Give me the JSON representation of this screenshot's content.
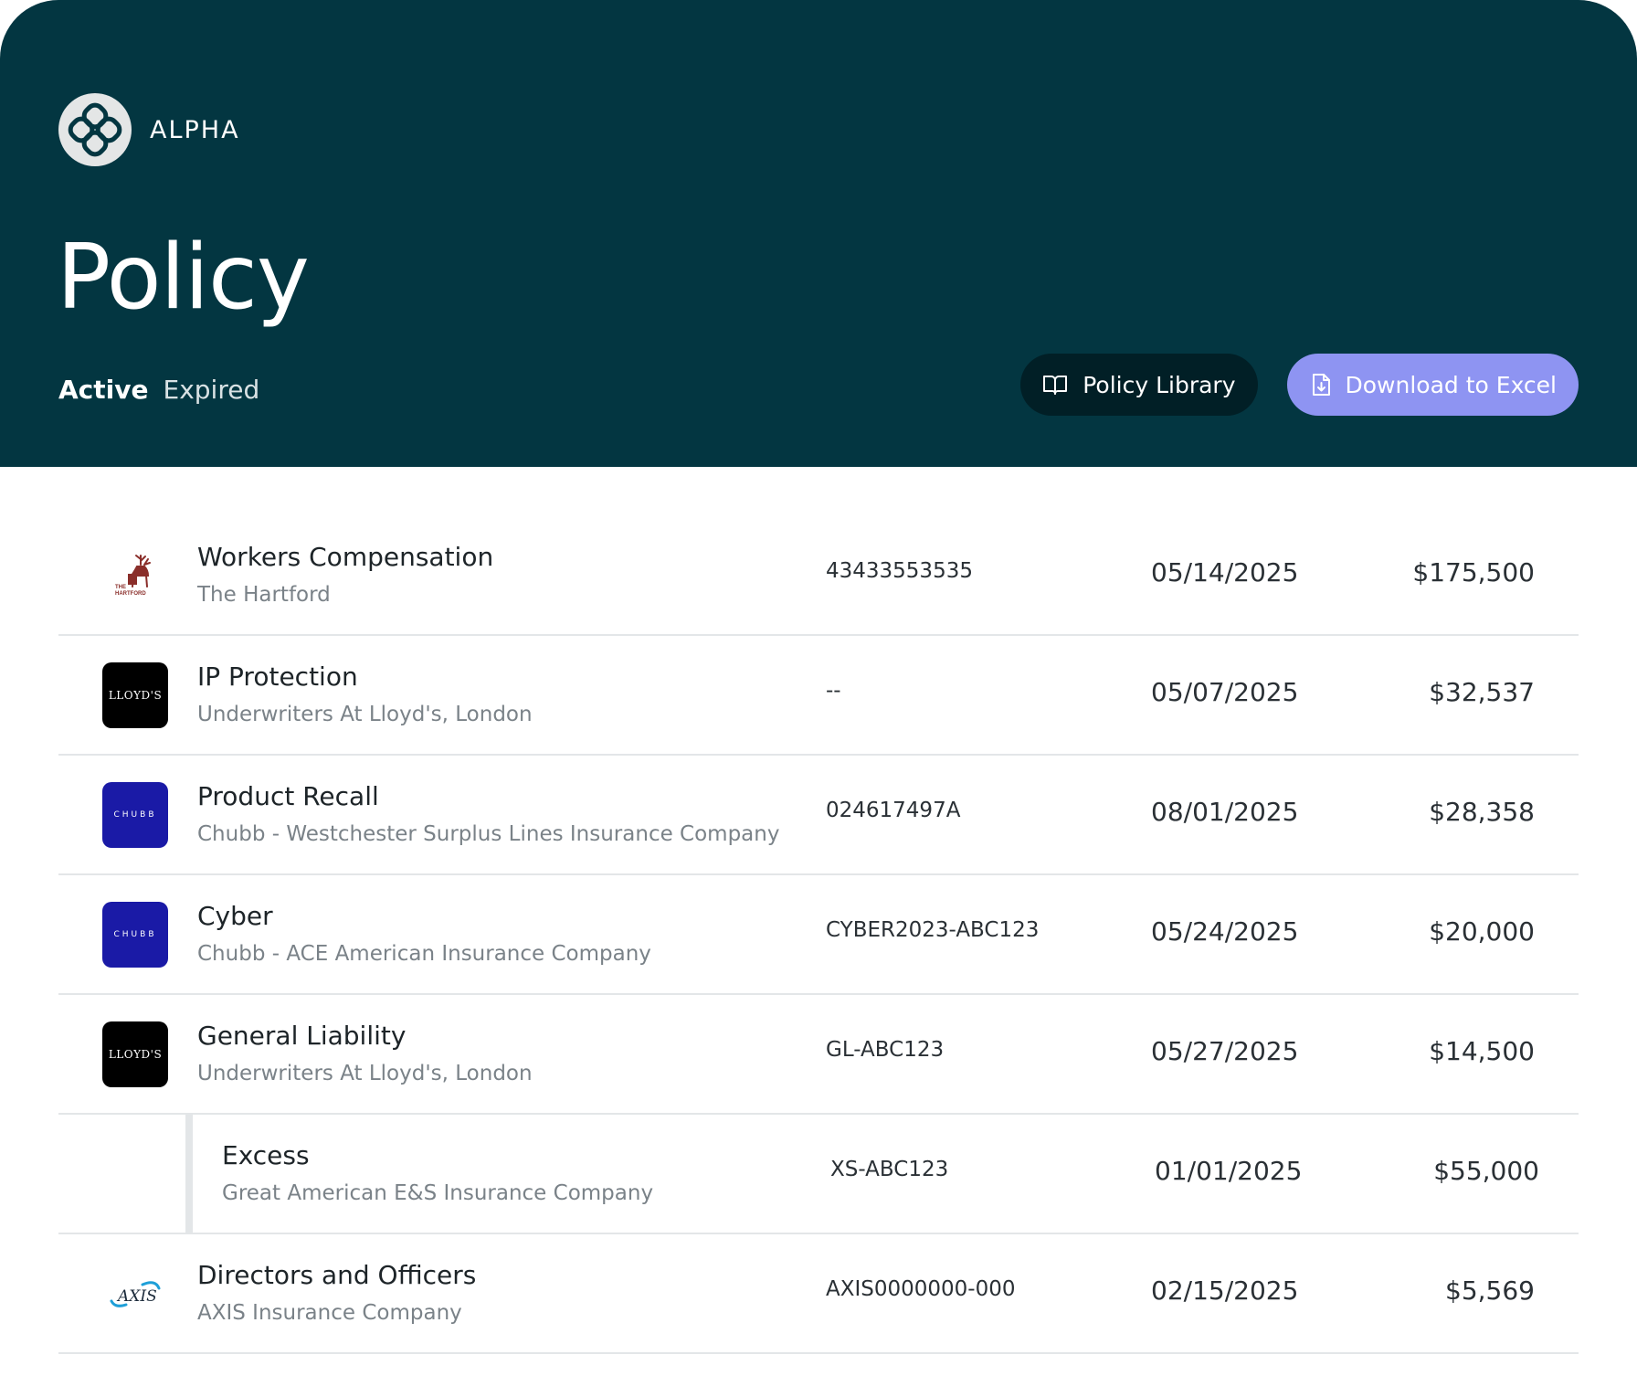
{
  "brand": {
    "name": "ALPHA",
    "logo_icon": "alpha-knot-logo"
  },
  "page": {
    "title": "Policy"
  },
  "tabs": [
    {
      "label": "Active",
      "active": true
    },
    {
      "label": "Expired",
      "active": false
    }
  ],
  "actions": {
    "policy_library": {
      "label": "Policy Library",
      "icon": "book-icon"
    },
    "download_excel": {
      "label": "Download to Excel",
      "icon": "file-download-icon"
    }
  },
  "colors": {
    "header_bg": "#033641",
    "dark_button": "#011f26",
    "accent_button": "#8e94f2",
    "chubb_blue": "#1a1aa6"
  },
  "policies": [
    {
      "name": "Workers Compensation",
      "insurer": "The Hartford",
      "policy_number": "43433553535",
      "date": "05/14/2025",
      "premium": "$175,500",
      "carrier_logo": "hartford",
      "logo_text": "THE HARTFORD"
    },
    {
      "name": "IP Protection",
      "insurer": "Underwriters At Lloyd's, London",
      "policy_number": "--",
      "date": "05/07/2025",
      "premium": "$32,537",
      "carrier_logo": "lloyds",
      "logo_text": "LLOYD'S"
    },
    {
      "name": "Product Recall",
      "insurer": "Chubb - Westchester Surplus Lines Insurance Company",
      "policy_number": "024617497A",
      "date": "08/01/2025",
      "premium": "$28,358",
      "carrier_logo": "chubb",
      "logo_text": "CHUBB"
    },
    {
      "name": "Cyber",
      "insurer": "Chubb - ACE American Insurance Company",
      "policy_number": "CYBER2023-ABC123",
      "date": "05/24/2025",
      "premium": "$20,000",
      "carrier_logo": "chubb",
      "logo_text": "CHUBB"
    },
    {
      "name": "General Liability",
      "insurer": "Underwriters At Lloyd's, London",
      "policy_number": "GL-ABC123",
      "date": "05/27/2025",
      "premium": "$14,500",
      "carrier_logo": "lloyds",
      "logo_text": "LLOYD'S"
    },
    {
      "name": "Excess",
      "insurer": "Great American E&S Insurance Company",
      "policy_number": "XS-ABC123",
      "date": "01/01/2025",
      "premium": "$55,000",
      "sub_policy": true
    },
    {
      "name": "Directors and Officers",
      "insurer": "AXIS Insurance Company",
      "policy_number": "AXIS0000000-000",
      "date": "02/15/2025",
      "premium": "$5,569",
      "carrier_logo": "axis",
      "logo_text": "AXIS"
    }
  ]
}
